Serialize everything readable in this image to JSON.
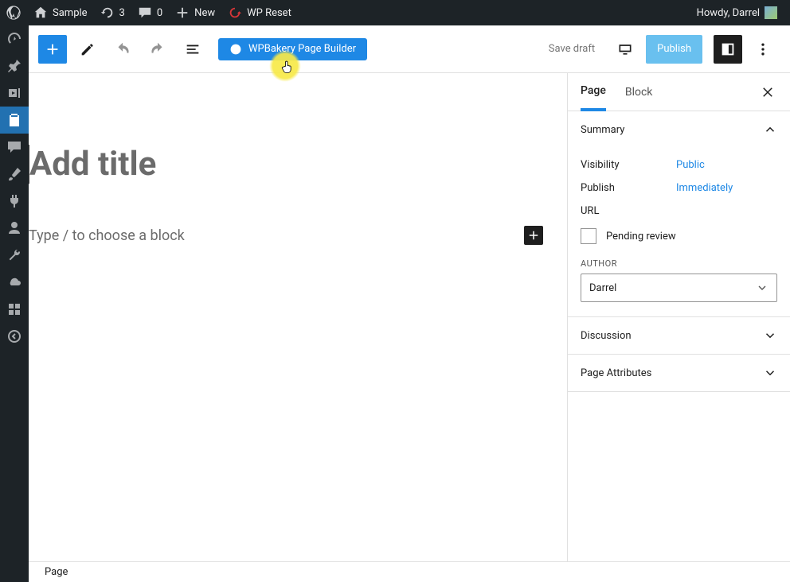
{
  "adminbar": {
    "site_name": "Sample",
    "updates_count": "3",
    "comments_count": "0",
    "new_label": "New",
    "wp_reset_label": "WP Reset",
    "greeting": "Howdy, Darrel"
  },
  "editor_toolbar": {
    "wpb_label": "WPBakery Page Builder",
    "save_draft": "Save draft",
    "publish": "Publish"
  },
  "canvas": {
    "title_placeholder": "Add title",
    "block_placeholder": "Type / to choose a block"
  },
  "settings": {
    "tabs": {
      "page": "Page",
      "block": "Block"
    },
    "summary": {
      "title": "Summary",
      "visibility_label": "Visibility",
      "visibility_value": "Public",
      "publish_label": "Publish",
      "publish_value": "Immediately",
      "url_label": "URL",
      "pending_review": "Pending review",
      "author_label": "AUTHOR",
      "author_value": "Darrel"
    },
    "discussion": "Discussion",
    "page_attributes": "Page Attributes"
  },
  "footer": {
    "breadcrumb": "Page"
  }
}
